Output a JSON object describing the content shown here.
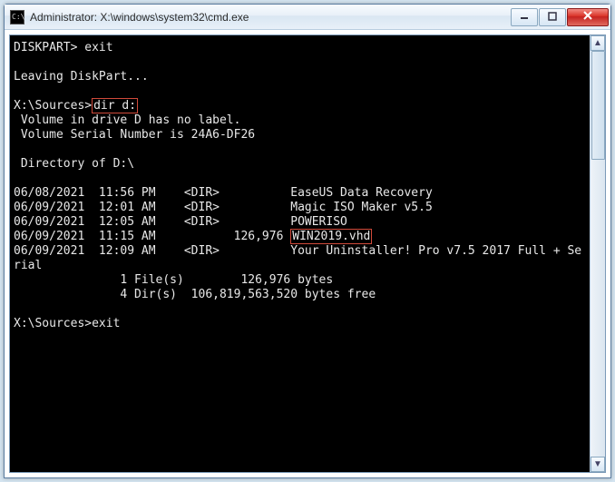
{
  "window": {
    "title": "Administrator: X:\\windows\\system32\\cmd.exe"
  },
  "term": {
    "p_diskpart": "DISKPART> ",
    "cmd_exit1": "exit",
    "blank": "",
    "leaving": "Leaving DiskPart...",
    "p_src1": "X:\\Sources>",
    "cmd_dir": "dir d:",
    "vol1": " Volume in drive D has no label.",
    "vol2": " Volume Serial Number is 24A6-DF26",
    "dirof": " Directory of D:\\",
    "r1": "06/08/2021  11:56 PM    <DIR>          EaseUS Data Recovery",
    "r2": "06/09/2021  12:01 AM    <DIR>          Magic ISO Maker v5.5",
    "r3": "06/09/2021  12:05 AM    <DIR>          POWERISO",
    "r4a": "06/09/2021  11:15 AM           126,976 ",
    "r4_file": "WIN2019.vhd",
    "r5": "06/09/2021  12:09 AM    <DIR>          Your Uninstaller! Pro v7.5 2017 Full + Se",
    "r5b": "rial",
    "sum1": "               1 File(s)        126,976 bytes",
    "sum2": "               4 Dir(s)  106,819,563,520 bytes free",
    "p_src2": "X:\\Sources>",
    "cmd_exit2": "exit"
  }
}
